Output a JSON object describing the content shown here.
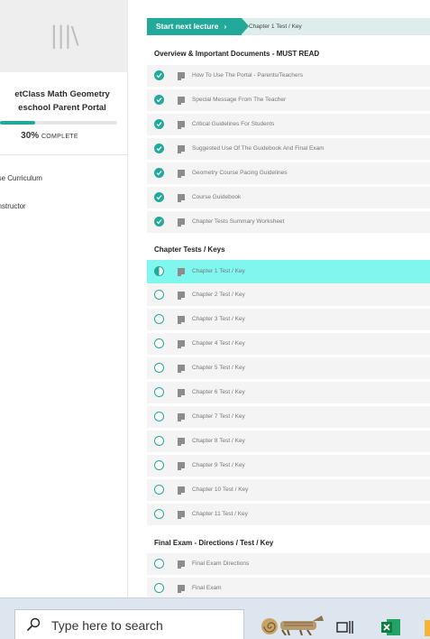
{
  "sidebar": {
    "logo_glyph": "|||\\",
    "course_title_line1": "etClass Math Geometry",
    "course_title_line2": "eschool Parent Portal",
    "progress_percent": 30,
    "progress_pct_text": "30%",
    "progress_word": "COMPLETE",
    "links": [
      "ourse Curriculum",
      "ur Instructor"
    ]
  },
  "main": {
    "next_button": "Start next lecture",
    "next_chevron": "›",
    "breadcrumb": "Chapter 1 Test / Key",
    "sections": [
      {
        "title": "Overview & Important Documents - MUST READ",
        "lectures": [
          {
            "label": "How To Use The Portal - Parents/Teachers",
            "status": "done"
          },
          {
            "label": "Special Message From The Teacher",
            "status": "done"
          },
          {
            "label": "Critical Guidelines For Students",
            "status": "done"
          },
          {
            "label": "Suggested Use Of The Guidebook And Final Exam",
            "status": "done"
          },
          {
            "label": "Geometry Course Pacing Guidelines",
            "status": "done"
          },
          {
            "label": "Course Guidebook",
            "status": "done"
          },
          {
            "label": "Chapter Tests Summary Worksheet",
            "status": "done"
          }
        ]
      },
      {
        "title": "Chapter Tests / Keys",
        "lectures": [
          {
            "label": "Chapter 1 Test / Key",
            "status": "in-progress"
          },
          {
            "label": "Chapter 2 Test / Key",
            "status": "todo"
          },
          {
            "label": "Chapter 3 Test / Key",
            "status": "todo"
          },
          {
            "label": "Chapter 4 Test / Key",
            "status": "todo"
          },
          {
            "label": "Chapter 5 Test / Key",
            "status": "todo"
          },
          {
            "label": "Chapter 6 Test / Key",
            "status": "todo"
          },
          {
            "label": "Chapter 7 Test / Key",
            "status": "todo"
          },
          {
            "label": "Chapter 8 Test / Key",
            "status": "todo"
          },
          {
            "label": "Chapter 9 Test / Key",
            "status": "todo"
          },
          {
            "label": "Chapter 10 Test / Key",
            "status": "todo"
          },
          {
            "label": "Chapter 11 Test / Key",
            "status": "todo"
          }
        ]
      },
      {
        "title": "Final Exam - Directions / Test / Key",
        "lectures": [
          {
            "label": "Final Exam Directions",
            "status": "todo"
          },
          {
            "label": "Final Exam",
            "status": "todo"
          }
        ]
      }
    ]
  },
  "taskbar": {
    "search_placeholder": "Type here to search",
    "icons": [
      "search-icon",
      "fossil-search-highlight",
      "task-view-icon",
      "excel-icon",
      "file-explorer-icon"
    ]
  },
  "colors": {
    "accent": "#23a99a",
    "active_row": "#7ff7ee",
    "row_bg": "#f4f4f4",
    "taskbar": "#dde5ee"
  }
}
